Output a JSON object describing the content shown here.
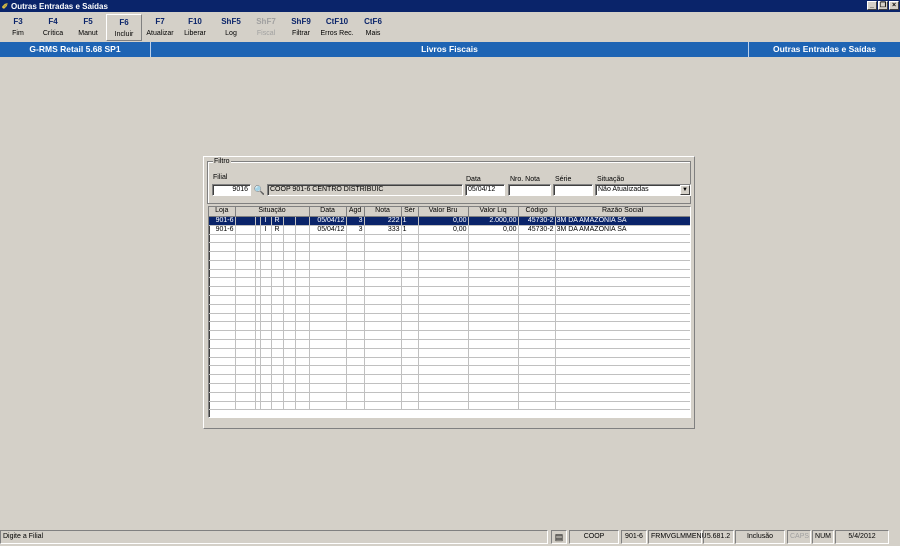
{
  "window": {
    "title": "Outras Entradas e Saídas"
  },
  "toolbar": {
    "keys": [
      {
        "key": "F3",
        "label": "Fim"
      },
      {
        "key": "F4",
        "label": "Crítica"
      },
      {
        "key": "F5",
        "label": "Manut"
      },
      {
        "key": "F6",
        "label": "Incluir"
      },
      {
        "key": "F7",
        "label": "Atualizar"
      },
      {
        "key": "F10",
        "label": "Liberar"
      },
      {
        "key": "ShF5",
        "label": "Log"
      },
      {
        "key": "ShF7",
        "label": "Fiscal"
      },
      {
        "key": "ShF9",
        "label": "Filtrar"
      },
      {
        "key": "CtF10",
        "label": "Erros Rec."
      },
      {
        "key": "CtF6",
        "label": "Mais"
      }
    ]
  },
  "header": {
    "version": "G-RMS Retail 5.68 SP1",
    "module": "Livros Fiscais",
    "screen": "Outras Entradas e Saídas"
  },
  "filter": {
    "legend": "Filtro",
    "filial_label": "Filial",
    "filial_value": "9016",
    "filial_desc": "COOP 901-6  CENTRO DISTRIBUIC",
    "data_label": "Data",
    "data_value": "05/04/12",
    "nota_label": "Nro. Nota",
    "nota_value": "",
    "serie_label": "Série",
    "serie_value": "",
    "situacao_label": "Situação",
    "situacao_value": "Não Atualizadas"
  },
  "grid": {
    "headers": {
      "loja": "Loja",
      "situacao": "Situação",
      "data": "Data",
      "agd": "Agd",
      "nota": "Nota",
      "ser": "Sér",
      "valor_bru": "Valor Bru",
      "valor_liq": "Valor Liq",
      "codigo": "Código",
      "razao": "Razão Social"
    },
    "rows": [
      {
        "loja": "901-6",
        "s1": "",
        "s2": "",
        "s3": "I",
        "s4": "R",
        "s5": "",
        "s6": "",
        "data": "05/04/12",
        "agd": "3",
        "nota": "222",
        "ser": "1",
        "valor_bru": "0,00",
        "valor_liq": "2.000,00",
        "codigo": "45730-2",
        "razao": "3M DA AMAZONIA SA"
      },
      {
        "loja": "901-6",
        "s1": "",
        "s2": "",
        "s3": "I",
        "s4": "R",
        "s5": "",
        "s6": "",
        "data": "05/04/12",
        "agd": "3",
        "nota": "333",
        "ser": "1",
        "valor_bru": "0,00",
        "valor_liq": "0,00",
        "codigo": "45730-2",
        "razao": "3M DA AMAZONIA SA"
      }
    ]
  },
  "status": {
    "message": "Digite a Filial",
    "company": "COOP",
    "branch": "901-6",
    "menu": "FRMVGLMMENU",
    "version": "5.681.2",
    "mode": "Inclusão",
    "caps": "CAPS",
    "num": "NUM",
    "date": "5/4/2012"
  }
}
